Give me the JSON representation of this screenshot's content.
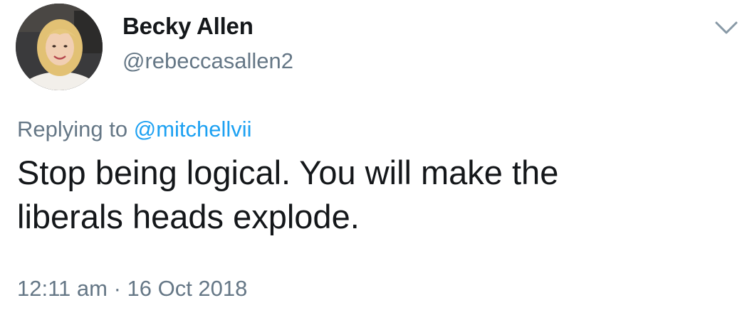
{
  "user": {
    "display_name": "Becky Allen",
    "handle": "@rebeccasallen2"
  },
  "reply": {
    "prefix": "Replying to ",
    "mention": "@mitchellvii"
  },
  "tweet": {
    "text_line_1": "Stop being logical. You will make the",
    "text_line_2": "liberals heads explode."
  },
  "meta": {
    "timestamp": "12:11 am · 16 Oct 2018"
  },
  "icons": {
    "menu": "chevron-down-icon",
    "avatar": "profile-photo"
  },
  "colors": {
    "text_primary": "#14171a",
    "text_secondary": "#657786",
    "link": "#1da1f2"
  }
}
